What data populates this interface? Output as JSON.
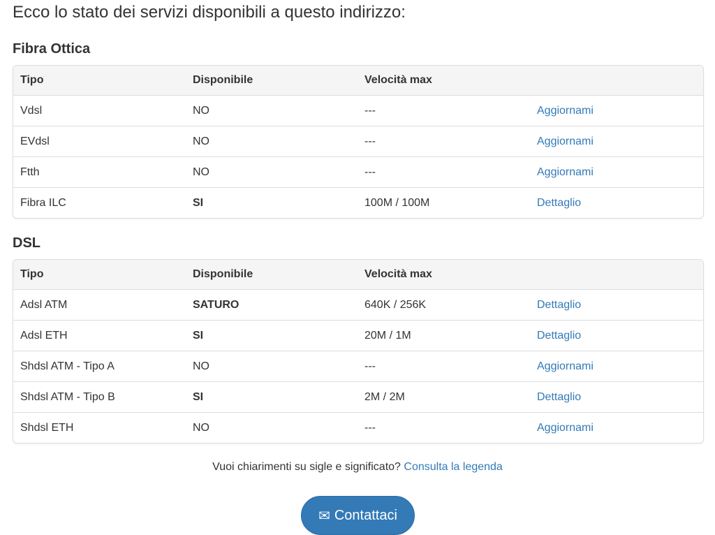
{
  "intro": "Ecco lo stato dei servizi disponibili a questo indirizzo:",
  "columns": [
    "Tipo",
    "Disponibile",
    "Velocità max",
    ""
  ],
  "sections": [
    {
      "title": "Fibra Ottica",
      "rows": [
        {
          "tipo": "Vdsl",
          "disponibile": "NO",
          "bold": false,
          "velocita": "---",
          "action": "Aggiornami"
        },
        {
          "tipo": "EVdsl",
          "disponibile": "NO",
          "bold": false,
          "velocita": "---",
          "action": "Aggiornami"
        },
        {
          "tipo": "Ftth",
          "disponibile": "NO",
          "bold": false,
          "velocita": "---",
          "action": "Aggiornami"
        },
        {
          "tipo": "Fibra ILC",
          "disponibile": "SI",
          "bold": true,
          "velocita": "100M / 100M",
          "action": "Dettaglio"
        }
      ]
    },
    {
      "title": "DSL",
      "rows": [
        {
          "tipo": "Adsl ATM",
          "disponibile": "SATURO",
          "bold": true,
          "velocita": "640K / 256K",
          "action": "Dettaglio"
        },
        {
          "tipo": "Adsl ETH",
          "disponibile": "SI",
          "bold": true,
          "velocita": "20M / 1M",
          "action": "Dettaglio"
        },
        {
          "tipo": "Shdsl ATM - Tipo A",
          "disponibile": "NO",
          "bold": false,
          "velocita": "---",
          "action": "Aggiornami"
        },
        {
          "tipo": "Shdsl ATM - Tipo B",
          "disponibile": "SI",
          "bold": true,
          "velocita": "2M / 2M",
          "action": "Dettaglio"
        },
        {
          "tipo": "Shdsl ETH",
          "disponibile": "NO",
          "bold": false,
          "velocita": "---",
          "action": "Aggiornami"
        }
      ]
    }
  ],
  "legend": {
    "question": "Vuoi chiarimenti su sigle e significato?",
    "link": "Consulta la legenda"
  },
  "contact": {
    "label": "Contattaci",
    "icon": "envelope-icon"
  },
  "colors": {
    "link": "#337ab7",
    "button": "#337ab7",
    "header_bg": "#f5f5f5"
  }
}
